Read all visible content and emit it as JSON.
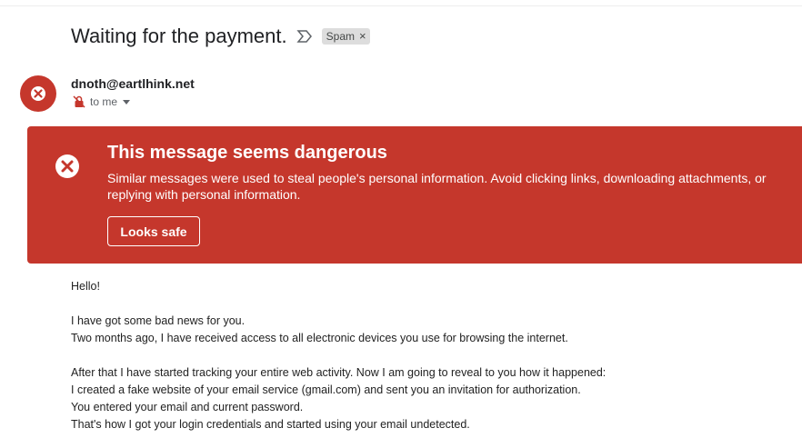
{
  "email": {
    "subject": "Waiting for the payment.",
    "label_chip": "Spam",
    "label_remove": "×",
    "sender": "dnoth@eartlhink.net",
    "recipient": "to me"
  },
  "warning": {
    "title": "This message seems dangerous",
    "text": "Similar messages were used to steal people's personal information. Avoid clicking links, downloading attachments, or replying with personal information.",
    "button": "Looks safe",
    "color": "#c5372c"
  },
  "body": {
    "greeting": "Hello!",
    "lines1": [
      "I have got some bad news for you.",
      "Two months ago, I have received access to all electronic devices you use for browsing the internet."
    ],
    "lines2": [
      "After that I have started tracking your entire web activity. Now I am going to reveal to you how it happened:",
      "I created a fake website of your email service (gmail.com) and sent you an invitation for authorization.",
      "You entered your email and current password.",
      "That's how I got your login credentials and started using your email undetected."
    ]
  },
  "icons": {
    "importance": "importance-marker-icon",
    "avatar": "warning-x-icon",
    "recipient": "unencrypted-lock-icon",
    "banner": "error-x-icon"
  }
}
